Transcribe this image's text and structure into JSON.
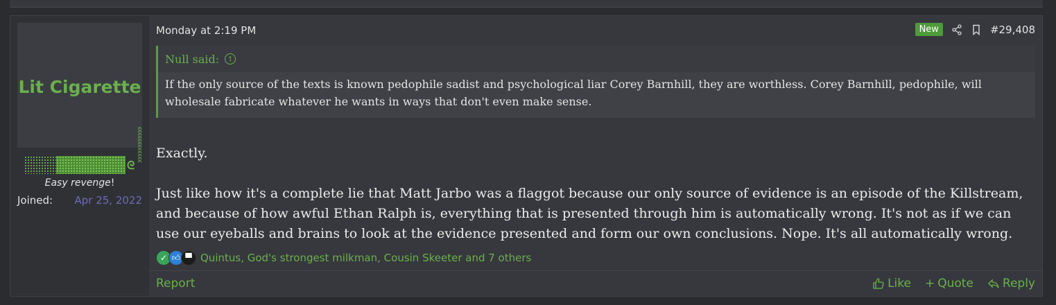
{
  "user": {
    "avatar_text": "Lit Cigarette",
    "avatar_snake": "ꞓꞓꞓꞓꞓꞓꞓꞓꞓꞓꞓꞓ",
    "title_italic": "Easy revenge",
    "title_bang": "!",
    "joined_label": "Joined:",
    "joined_date": "Apr 25, 2022"
  },
  "post": {
    "date": "Monday at 2:19 PM",
    "new_badge": "New",
    "number": "#29,408",
    "quote": {
      "author": "Null said:",
      "text": "If the only source of the texts is known pedophile sadist and psychological liar Corey Barnhill, they are worthless. Corey Barnhill, pedophile, will wholesale fabricate whatever he wants in ways that don't even make sense."
    },
    "paragraphs": [
      "Exactly.",
      "Just like how it's a complete lie that Matt Jarbo was a flaggot because our only source of evidence is an episode of the Killstream, and because of how awful Ethan Ralph is, everything that is presented through him is automatically wrong. It's not as if we can use our eyeballs and brains to look at the evidence presented and form our own conclusions. Nope. It's all automatically wrong."
    ],
    "reactions_text": "Quintus, God's strongest milkman, Cousin Skeeter and 7 others",
    "reaction_icons": [
      "check-reaction-icon",
      "like-reaction-icon",
      "top-hat-reaction-icon"
    ]
  },
  "footer": {
    "report": "Report",
    "like": "Like",
    "quote": "Quote",
    "reply": "Reply"
  },
  "colors": {
    "accent": "#6ab04c",
    "background": "#2a2c30",
    "post": "#36383d",
    "new_badge": "#4d9b3a",
    "joined_date": "#6f6ab8"
  }
}
